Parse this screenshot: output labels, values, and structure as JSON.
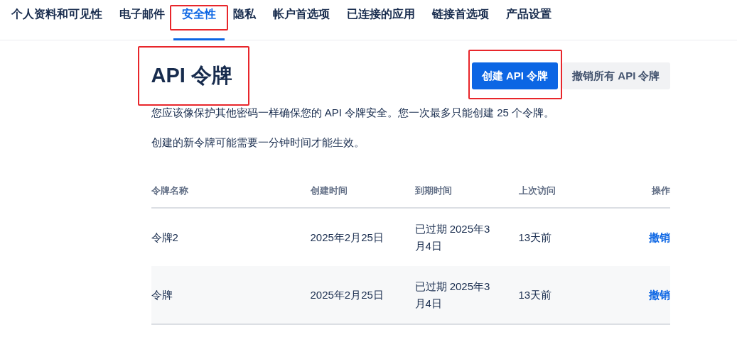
{
  "tabs": [
    {
      "label": "个人资料和可见性",
      "selected": false,
      "highlighted": false
    },
    {
      "label": "电子邮件",
      "selected": false,
      "highlighted": false
    },
    {
      "label": "安全性",
      "selected": true,
      "highlighted": true
    },
    {
      "label": "隐私",
      "selected": false,
      "highlighted": false
    },
    {
      "label": "帐户首选项",
      "selected": false,
      "highlighted": false
    },
    {
      "label": "已连接的应用",
      "selected": false,
      "highlighted": false
    },
    {
      "label": "链接首选项",
      "selected": false,
      "highlighted": false
    },
    {
      "label": "产品设置",
      "selected": false,
      "highlighted": false
    }
  ],
  "heading": {
    "title": "API 令牌",
    "highlighted": true
  },
  "buttons": [
    {
      "label": "创建 API 令牌",
      "kind": "primary",
      "highlighted": true
    },
    {
      "label": "撤销所有 API 令牌",
      "kind": "secondary",
      "highlighted": false
    }
  ],
  "paragraphs": [
    "您应该像保护其他密码一样确保您的 API 令牌安全。您一次最多只能创建 25 个令牌。",
    "创建的新令牌可能需要一分钟时间才能生效。"
  ],
  "table": {
    "columns": [
      "令牌名称",
      "创建时间",
      "到期时间",
      "上次访问",
      "操作"
    ],
    "rows": [
      {
        "name": "令牌2",
        "created": "2025年2月25日",
        "expires": "已过期 2025年3月4日",
        "last_access": "13天前",
        "action": "撤销"
      },
      {
        "name": "令牌",
        "created": "2025年2月25日",
        "expires": "已过期 2025年3月4日",
        "last_access": "13天前",
        "action": "撤销"
      }
    ]
  }
}
